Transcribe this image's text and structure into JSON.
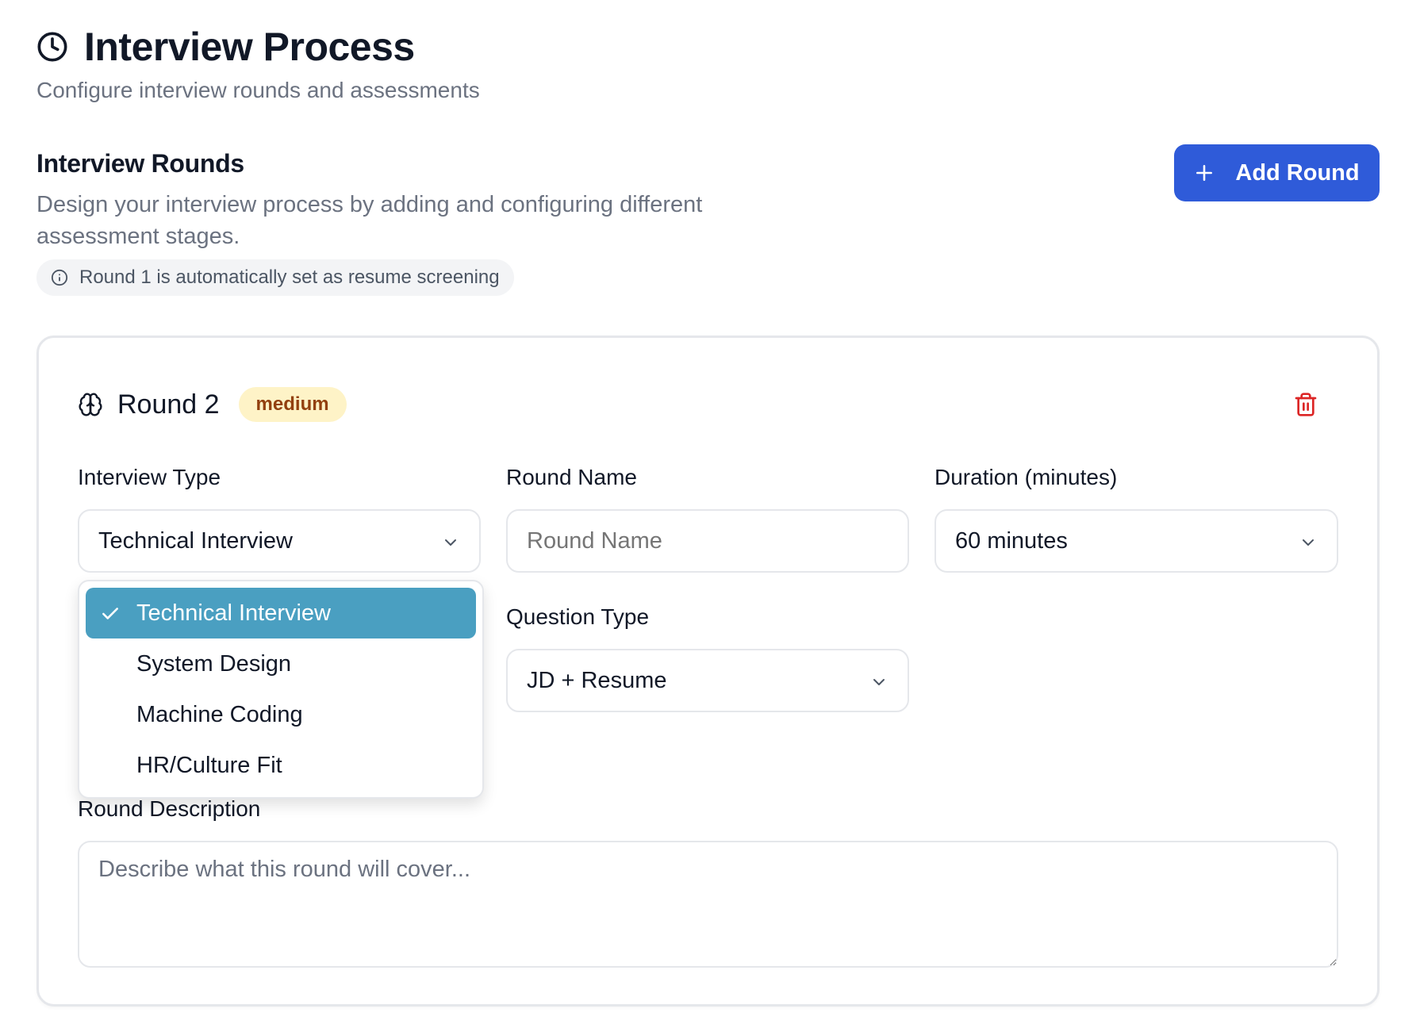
{
  "header": {
    "title": "Interview Process",
    "subtitle": "Configure interview rounds and assessments"
  },
  "section": {
    "title": "Interview Rounds",
    "description": "Design your interview process by adding and configuring different assessment stages.",
    "info": "Round 1 is automatically set as resume screening",
    "add_button_label": "Add Round"
  },
  "round": {
    "title": "Round 2",
    "badge": "medium",
    "interview_type": {
      "label": "Interview Type",
      "value": "Technical Interview"
    },
    "round_name": {
      "label": "Round Name",
      "placeholder": "Round Name",
      "value": ""
    },
    "duration": {
      "label": "Duration (minutes)",
      "value": "60 minutes"
    },
    "question_type": {
      "label": "Question Type",
      "value": "JD + Resume"
    },
    "description": {
      "label": "Round Description",
      "placeholder": "Describe what this round will cover..."
    }
  },
  "dropdown": {
    "options": [
      {
        "label": "Technical Interview",
        "selected": true
      },
      {
        "label": "System Design",
        "selected": false
      },
      {
        "label": "Machine Coding",
        "selected": false
      },
      {
        "label": "HR/Culture Fit",
        "selected": false
      }
    ]
  },
  "colors": {
    "primary": "#2f5bd9",
    "selected_option": "#4a9fc1",
    "badge_bg": "#fef3c7",
    "badge_text": "#92400e",
    "danger": "#dc2626"
  }
}
